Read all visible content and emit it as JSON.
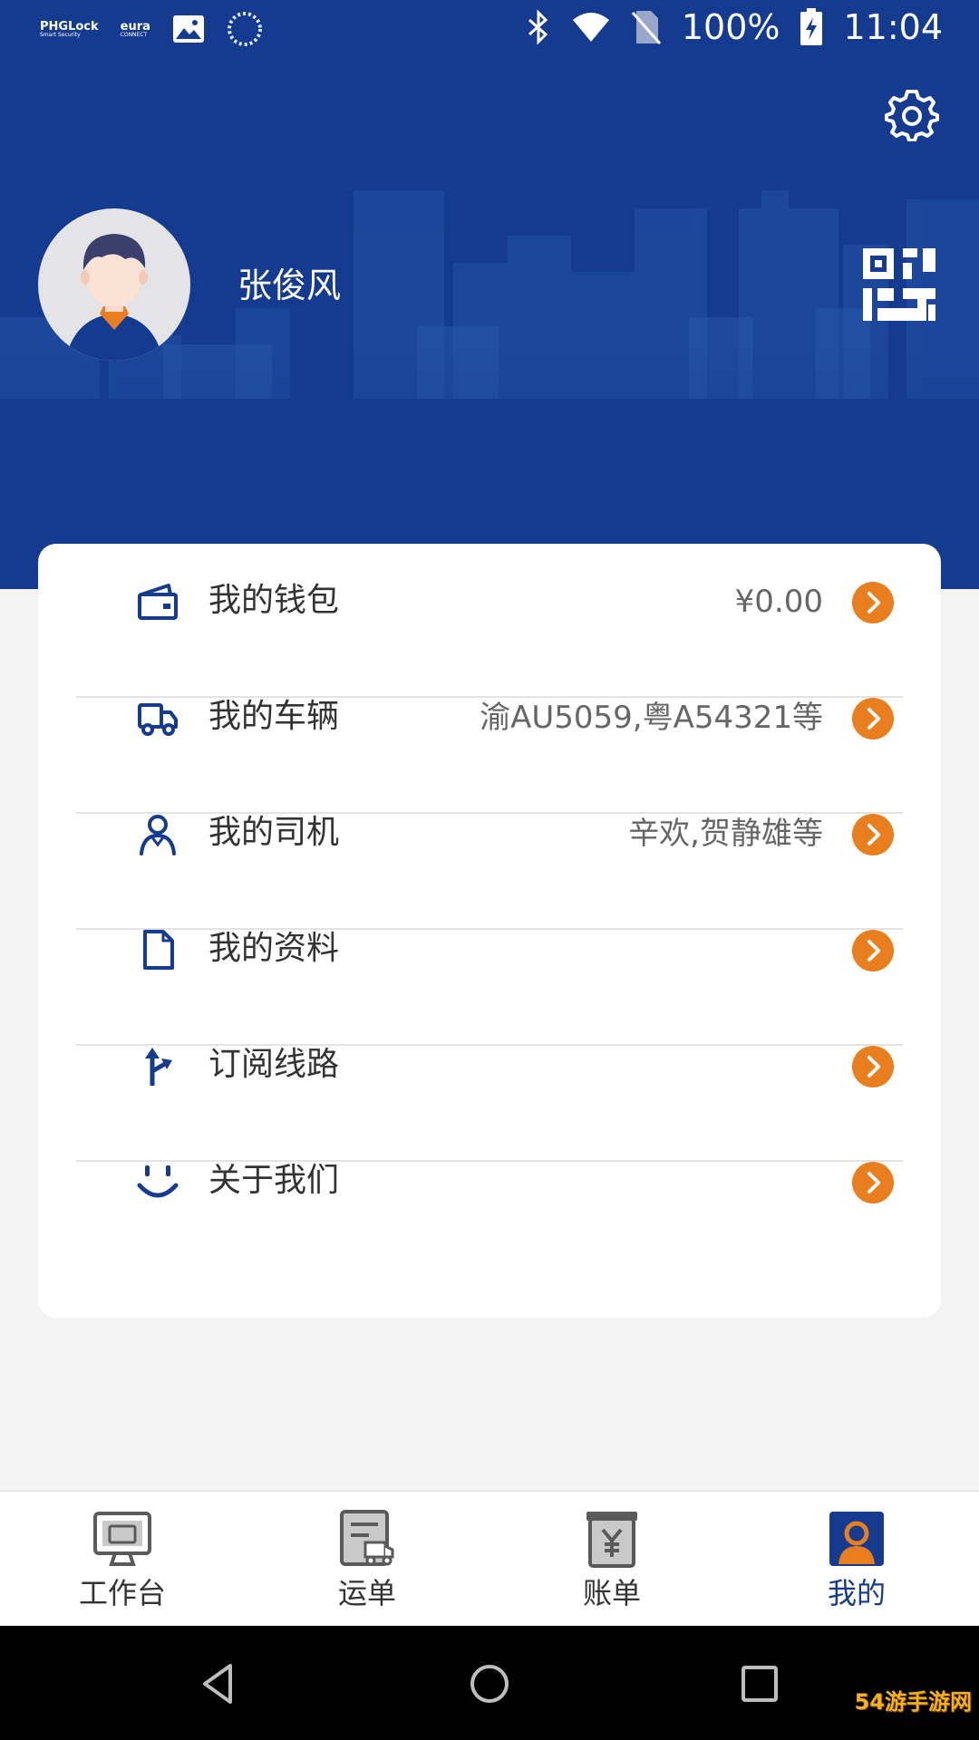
{
  "status_bar": {
    "app_icons": [
      "PHGLock",
      "eura"
    ],
    "battery": "100%",
    "time": "11:04"
  },
  "profile": {
    "name": "张俊风"
  },
  "menu": [
    {
      "label": "我的钱包",
      "value": "¥0.00",
      "icon": "wallet-icon"
    },
    {
      "label": "我的车辆",
      "value": "渝AU5059,粤A54321等",
      "icon": "truck-icon"
    },
    {
      "label": "我的司机",
      "value": "辛欢,贺静雄等",
      "icon": "person-icon"
    },
    {
      "label": "我的资料",
      "value": "",
      "icon": "document-icon"
    },
    {
      "label": "订阅线路",
      "value": "",
      "icon": "route-icon"
    },
    {
      "label": "关于我们",
      "value": "",
      "icon": "smile-icon"
    }
  ],
  "tabs": [
    {
      "label": "工作台",
      "icon": "workbench-icon",
      "active": false
    },
    {
      "label": "运单",
      "icon": "waybill-icon",
      "active": false
    },
    {
      "label": "账单",
      "icon": "bill-icon",
      "active": false
    },
    {
      "label": "我的",
      "icon": "profile-icon",
      "active": true
    }
  ],
  "watermark": "54游手游网",
  "colors": {
    "brand_blue": "#143b8f",
    "accent_orange": "#e87e1d",
    "background": "#f4f4f4"
  }
}
